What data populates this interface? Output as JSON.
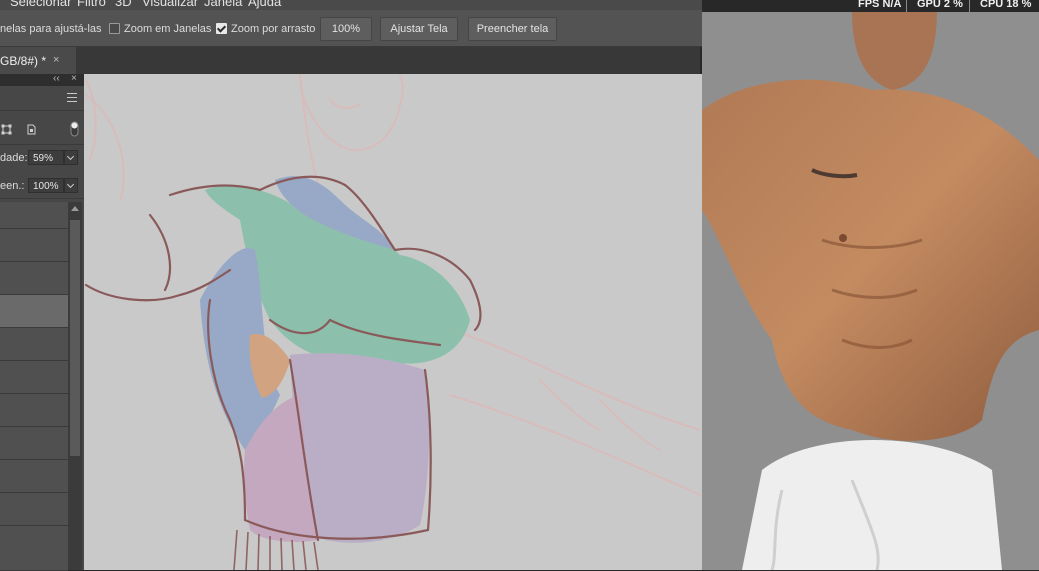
{
  "menubar": {
    "items": [
      "Selecionar",
      "Filtro",
      "3D",
      "Visualizar",
      "Janela",
      "Ajuda"
    ]
  },
  "options_bar": {
    "resize_label": "nelas para ajustá-las",
    "zoom_all_windows": {
      "label": "Zoom em Janelas",
      "checked": false
    },
    "scrubby_zoom": {
      "label": "Zoom por arrasto",
      "checked": true
    },
    "zoom_value": "100%",
    "fit_screen": "Ajustar Tela",
    "fill_screen": "Preencher tela"
  },
  "document_tab": {
    "title": "GB/8#) *",
    "close": "×"
  },
  "layers_panel": {
    "collapse_glyph": "‹‹",
    "close_glyph": "×",
    "opacity_label": "dade:",
    "opacity_value": "59%",
    "fill_label": "een.:",
    "fill_value": "100%",
    "selected_layer_index": 3
  },
  "stats": {
    "fps": "FPS  N/A",
    "gpu": "GPU  2 %",
    "cpu": "CPU  18 %"
  },
  "colors": {
    "teal_region": "#7fbfa5",
    "blue_region": "#8ba2c6",
    "purple_region": "#b7a8c6",
    "pink_region": "#c4a0bd",
    "orange_region": "#d39a6e",
    "sketch_line": "#8a5a5a"
  }
}
